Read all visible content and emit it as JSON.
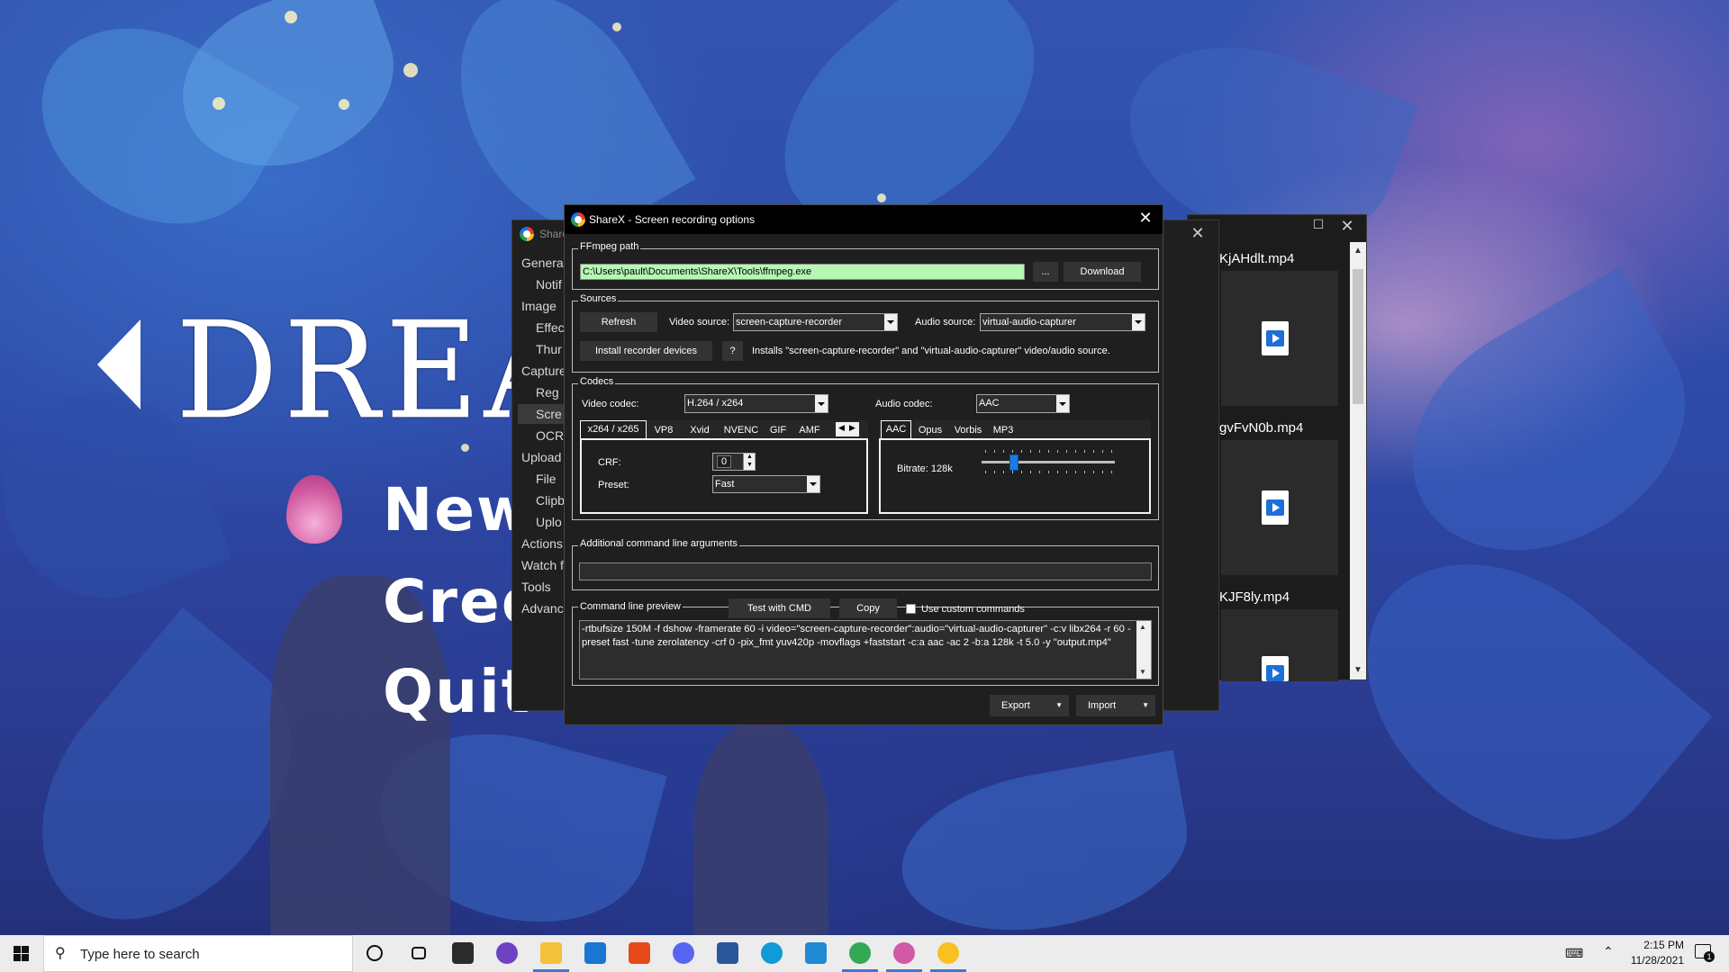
{
  "desktop": {
    "game_title": "DREAM",
    "game_menu": [
      "New",
      "Cred",
      "Quit"
    ]
  },
  "sharex_main": {
    "title": "ShareX",
    "nav": [
      {
        "label": "Genera",
        "indent": false
      },
      {
        "label": "Notif",
        "indent": true
      },
      {
        "label": "Image",
        "indent": false
      },
      {
        "label": "Effec",
        "indent": true
      },
      {
        "label": "Thur",
        "indent": true
      },
      {
        "label": "Capture",
        "indent": false
      },
      {
        "label": "Reg",
        "indent": true
      },
      {
        "label": "Scre",
        "indent": true,
        "selected": true
      },
      {
        "label": "OCR",
        "indent": true
      },
      {
        "label": "Upload",
        "indent": false
      },
      {
        "label": "File",
        "indent": true
      },
      {
        "label": "Clipb",
        "indent": true
      },
      {
        "label": "Uplo",
        "indent": true
      },
      {
        "label": "Actions",
        "indent": false
      },
      {
        "label": "Watch f",
        "indent": false
      },
      {
        "label": "Tools",
        "indent": false
      },
      {
        "label": "Advanc",
        "indent": false
      }
    ]
  },
  "explorer": {
    "files": [
      "KjAHdlt.mp4",
      "gvFvN0b.mp4",
      "KJF8ly.mp4"
    ]
  },
  "dialog": {
    "title": "ShareX - Screen recording options",
    "ffmpeg": {
      "group_label": "FFmpeg path",
      "path": "C:\\Users\\pault\\Documents\\ShareX\\Tools\\ffmpeg.exe",
      "browse_label": "...",
      "download_label": "Download"
    },
    "sources": {
      "group_label": "Sources",
      "refresh_label": "Refresh",
      "video_source_label": "Video source:",
      "video_source_value": "screen-capture-recorder",
      "audio_source_label": "Audio source:",
      "audio_source_value": "virtual-audio-capturer",
      "install_label": "Install recorder devices",
      "help_label": "?",
      "install_note": "Installs \"screen-capture-recorder\" and \"virtual-audio-capturer\" video/audio source."
    },
    "codecs": {
      "group_label": "Codecs",
      "video_codec_label": "Video codec:",
      "video_codec_value": "H.264 / x264",
      "audio_codec_label": "Audio codec:",
      "audio_codec_value": "AAC",
      "video_tabs": [
        "x264 / x265",
        "VP8",
        "Xvid",
        "NVENC",
        "GIF",
        "AMF"
      ],
      "audio_tabs": [
        "AAC",
        "Opus",
        "Vorbis",
        "MP3"
      ],
      "crf_label": "CRF:",
      "crf_value": "0",
      "preset_label": "Preset:",
      "preset_value": "Fast",
      "bitrate_label": "Bitrate: 128k",
      "bitrate_fraction": 0.22
    },
    "additional_args": {
      "group_label": "Additional command line arguments",
      "value": ""
    },
    "preview": {
      "group_label": "Command line preview",
      "test_label": "Test with CMD",
      "copy_label": "Copy",
      "custom_label": "Use custom commands",
      "custom_checked": false,
      "text": "-rtbufsize 150M -f dshow -framerate 60 -i video=\"screen-capture-recorder\":audio=\"virtual-audio-capturer\" -c:v libx264 -r 60 -preset fast -tune zerolatency -crf 0 -pix_fmt yuv420p -movflags +faststart -c:a aac -ac 2 -b:a 128k -t 5.0 -y \"output.mp4\""
    },
    "footer": {
      "export_label": "Export",
      "import_label": "Import"
    }
  },
  "taskbar": {
    "search_placeholder": "Type here to search",
    "icons": [
      {
        "name": "cortana",
        "color": "#111111"
      },
      {
        "name": "task-view",
        "color": "#111111"
      },
      {
        "name": "store",
        "color": "#2b2b2b"
      },
      {
        "name": "github-desktop",
        "color": "#6f42c1"
      },
      {
        "name": "file-explorer",
        "color": "#f3c13a"
      },
      {
        "name": "mail",
        "color": "#1976d2"
      },
      {
        "name": "office",
        "color": "#e64a19"
      },
      {
        "name": "discord",
        "color": "#5865f2"
      },
      {
        "name": "word",
        "color": "#2b579a"
      },
      {
        "name": "edge",
        "color": "#0f9bd7"
      },
      {
        "name": "vscode",
        "color": "#1f8ad2"
      },
      {
        "name": "chrome",
        "color": "#34a853"
      },
      {
        "name": "game",
        "color": "#d05aa5"
      },
      {
        "name": "sharex",
        "color": "#f8c021"
      }
    ],
    "time": "2:15 PM",
    "date": "11/28/2021",
    "notification_count": "1"
  }
}
